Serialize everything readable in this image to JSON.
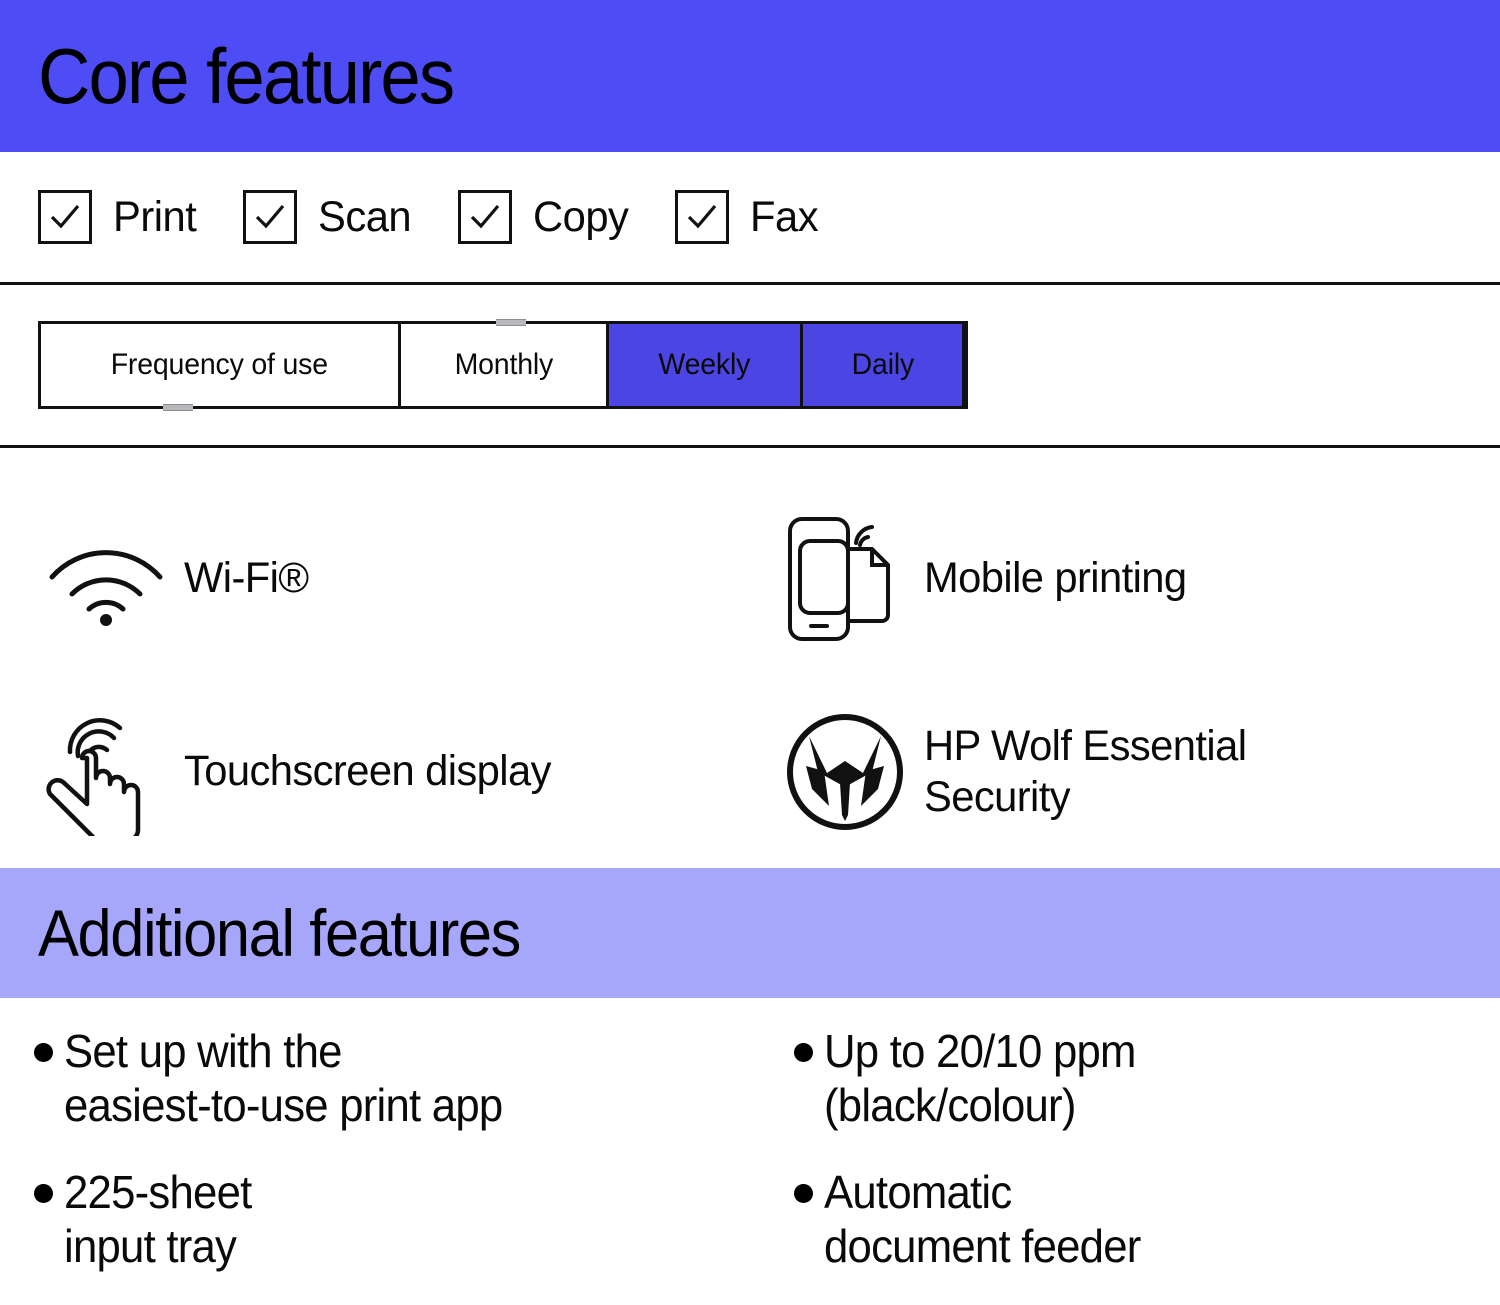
{
  "core_section": {
    "title": "Core features",
    "banner_color": "#4E4DF5",
    "capabilities": [
      {
        "label": "Print",
        "checked": true,
        "icon": "checkmark-icon"
      },
      {
        "label": "Scan",
        "checked": true,
        "icon": "checkmark-icon"
      },
      {
        "label": "Copy",
        "checked": true,
        "icon": "checkmark-icon"
      },
      {
        "label": "Fax",
        "checked": true,
        "icon": "checkmark-icon"
      }
    ],
    "frequency": {
      "label": "Frequency of use",
      "options": [
        {
          "label": "Monthly",
          "selected": false
        },
        {
          "label": "Weekly",
          "selected": true
        },
        {
          "label": "Daily",
          "selected": true
        }
      ],
      "selected_color": "#4B45E4"
    },
    "features": [
      {
        "label": "Wi-Fi®",
        "icon": "wifi-icon"
      },
      {
        "label": "Mobile printing",
        "icon": "mobile-printing-icon"
      },
      {
        "label": "Touchscreen display",
        "icon": "touchscreen-icon"
      },
      {
        "label": "HP Wolf Essential\nSecurity",
        "icon": "hp-wolf-security-icon"
      }
    ]
  },
  "additional_section": {
    "title": "Additional features",
    "banner_color": "#A6A6FB",
    "bullets_left": [
      "Set up with the\neasiest-to-use print app",
      "225-sheet\ninput tray"
    ],
    "bullets_right": [
      "Up to 20/10 ppm\n(black/colour)",
      "Automatic\ndocument feeder"
    ]
  }
}
